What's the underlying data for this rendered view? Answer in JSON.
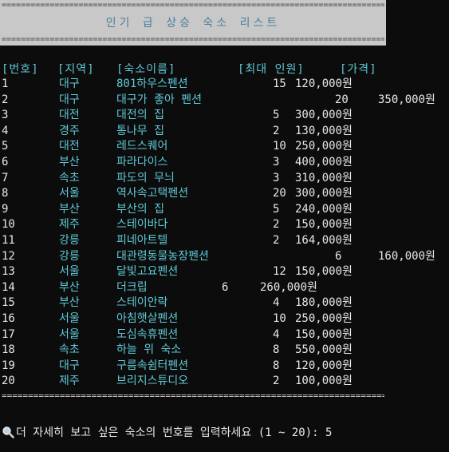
{
  "title": "인기 급 상승 숙소 리스트",
  "separator": "=================================================================================",
  "headers": [
    "[번호]",
    "[지역]",
    "[숙소이름]",
    "[최대 인원]",
    "[가격]"
  ],
  "rows": [
    {
      "no": "1",
      "region": "대구",
      "name": "801하우스펜션",
      "max": "15",
      "price": "120,000원",
      "layout": "normal"
    },
    {
      "no": "2",
      "region": "대구",
      "name": "대구가 좋아 펜션",
      "max": "20",
      "price": "350,000원",
      "layout": "wide"
    },
    {
      "no": "3",
      "region": "대전",
      "name": "대전의 집",
      "max": "5",
      "price": "300,000원",
      "layout": "normal"
    },
    {
      "no": "4",
      "region": "경주",
      "name": "통나무 집",
      "max": "2",
      "price": "130,000원",
      "layout": "normal"
    },
    {
      "no": "5",
      "region": "대전",
      "name": "레드스퀘어",
      "max": "10",
      "price": "250,000원",
      "layout": "normal"
    },
    {
      "no": "6",
      "region": "부산",
      "name": "파라다이스",
      "max": "3",
      "price": "400,000원",
      "layout": "normal"
    },
    {
      "no": "7",
      "region": "속초",
      "name": "파도의 무늬",
      "max": "3",
      "price": "310,000원",
      "layout": "normal"
    },
    {
      "no": "8",
      "region": "서울",
      "name": "역사속고택펜션",
      "max": "20",
      "price": "300,000원",
      "layout": "normal"
    },
    {
      "no": "9",
      "region": "부산",
      "name": "부산의 집",
      "max": "5",
      "price": "240,000원",
      "layout": "normal"
    },
    {
      "no": "10",
      "region": "제주",
      "name": "스테이바다",
      "max": "2",
      "price": "150,000원",
      "layout": "normal"
    },
    {
      "no": "11",
      "region": "강릉",
      "name": "피네아트텔",
      "max": "2",
      "price": "164,000원",
      "layout": "normal"
    },
    {
      "no": "12",
      "region": "강릉",
      "name": "대관령동물농장펜션",
      "max": "6",
      "price": "160,000원",
      "layout": "wide"
    },
    {
      "no": "13",
      "region": "서울",
      "name": "달빛고요펜션",
      "max": "12",
      "price": "150,000원",
      "layout": "normal"
    },
    {
      "no": "14",
      "region": "부산",
      "name": "더크립",
      "max": "6",
      "price": "260,000원",
      "layout": "narrow"
    },
    {
      "no": "15",
      "region": "부산",
      "name": "스테이안락",
      "max": "4",
      "price": "180,000원",
      "layout": "normal"
    },
    {
      "no": "16",
      "region": "서울",
      "name": "아침햇살펜션",
      "max": "10",
      "price": "250,000원",
      "layout": "normal"
    },
    {
      "no": "17",
      "region": "서울",
      "name": "도심속휴펜션",
      "max": "4",
      "price": "150,000원",
      "layout": "normal"
    },
    {
      "no": "18",
      "region": "속초",
      "name": "하늘 위 숙소",
      "max": "8",
      "price": "550,000원",
      "layout": "normal"
    },
    {
      "no": "19",
      "region": "대구",
      "name": "구름속쉼터펜션",
      "max": "8",
      "price": "120,000원",
      "layout": "normal"
    },
    {
      "no": "20",
      "region": "제주",
      "name": "브리지스튜디오",
      "max": "2",
      "price": "100,000원",
      "layout": "normal"
    }
  ],
  "prompt": {
    "icon": "magnifier-icon",
    "text": "더 자세히 보고 싶은 숙소의 번호를 입력하세요 (1 ~ 20): ",
    "input_value": "5"
  },
  "colors": {
    "cyan": "#5fc9d6",
    "title": "#4b7f9d",
    "title_bg": "#c8c8c8"
  }
}
